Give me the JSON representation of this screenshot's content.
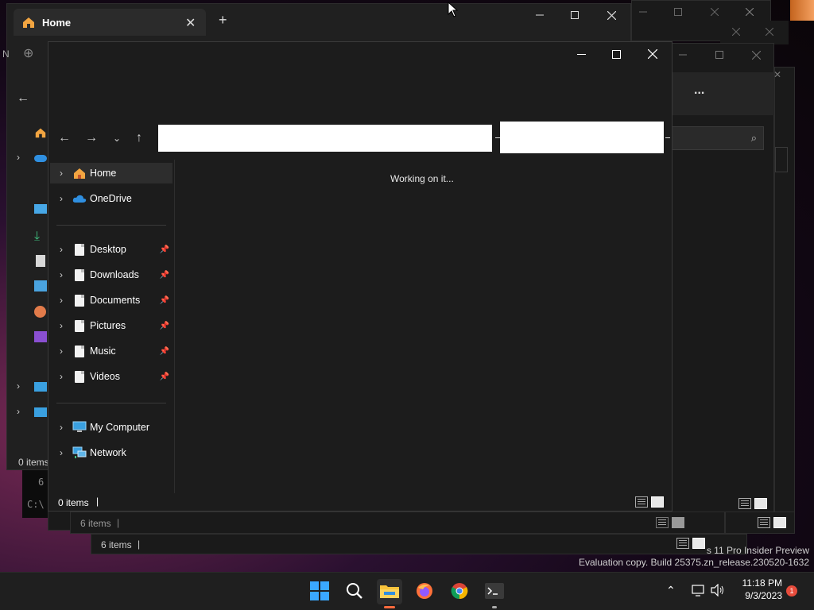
{
  "background_windows": {
    "tab_title": "Home",
    "new_tab_symbol": "+",
    "partial_label": "N",
    "left_status": "0 items",
    "terminal_text_1": "6",
    "terminal_text_2": "C:\\",
    "status_a": "6 items",
    "status_b": "6 items",
    "more_symbol": "..."
  },
  "main_window": {
    "loading_text": "Working on it...",
    "status_text": "0 items",
    "nav_quick": [
      {
        "label": "Home",
        "icon": "home-icon"
      },
      {
        "label": "OneDrive",
        "icon": "cloud-icon"
      }
    ],
    "nav_pinned": [
      {
        "label": "Desktop",
        "icon": "file-icon"
      },
      {
        "label": "Downloads",
        "icon": "file-icon"
      },
      {
        "label": "Documents",
        "icon": "file-icon"
      },
      {
        "label": "Pictures",
        "icon": "file-icon"
      },
      {
        "label": "Music",
        "icon": "file-icon"
      },
      {
        "label": "Videos",
        "icon": "file-icon"
      }
    ],
    "nav_system": [
      {
        "label": "My Computer",
        "icon": "computer-icon"
      },
      {
        "label": "Network",
        "icon": "network-icon"
      }
    ]
  },
  "watermark": {
    "line1": "s 11 Pro Insider Preview",
    "line2": "Evaluation copy. Build 25375.zn_release.230520-1632"
  },
  "taskbar": {
    "time": "11:18 PM",
    "date": "9/3/2023",
    "notification_count": "1"
  },
  "colors": {
    "window_bg": "#1c1c1c",
    "taskbar_bg": "#1f1f1f",
    "accent_orange": "#f9a825",
    "notify_red": "#e74c3c"
  }
}
